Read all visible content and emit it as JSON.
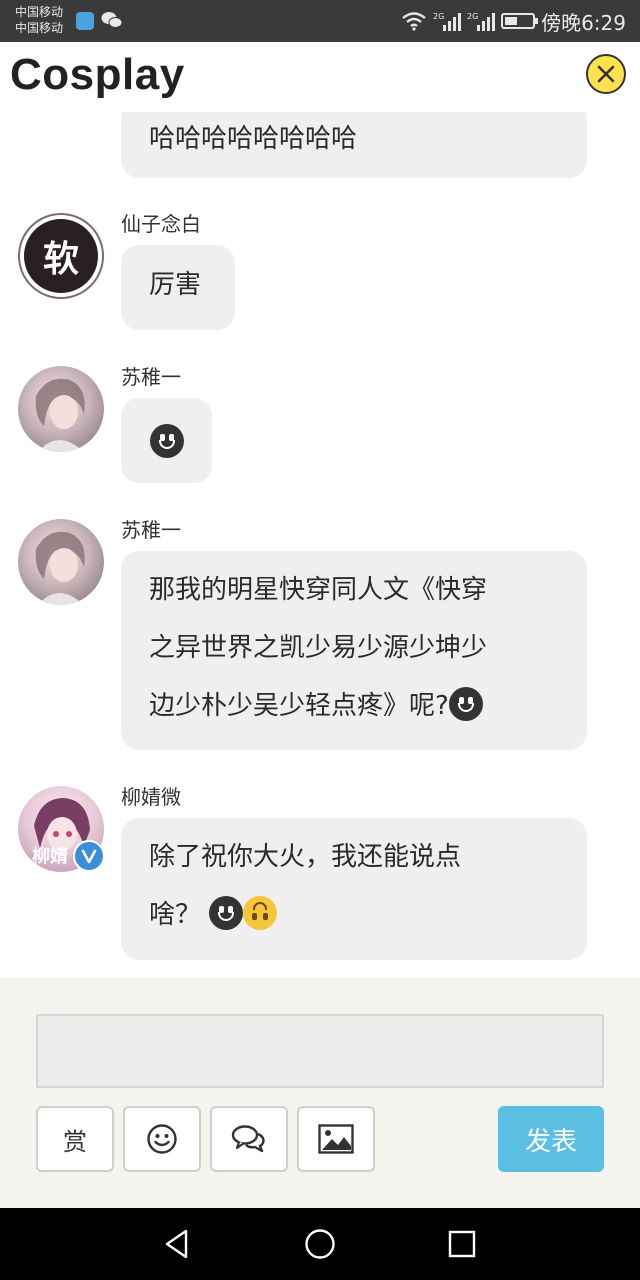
{
  "status_bar": {
    "carrier1": "中国移动",
    "carrier2": "中国移动",
    "network_label1": "2G",
    "network_label2": "2G",
    "time": "傍晚6:29",
    "battery_level": 0.45
  },
  "header": {
    "title": "Cosplay",
    "close_icon": "close-circle-icon"
  },
  "messages": [
    {
      "name": "",
      "text": "哈哈哈哈哈哈哈哈"
    },
    {
      "name": "仙子念白",
      "avatar_text": "软",
      "text": "厉害"
    },
    {
      "name": "苏稚一",
      "text": ""
    },
    {
      "name": "苏稚一",
      "text_lines": [
        "那我的明星快穿同人文《快穿",
        "之异世界之凯少易少源少坤少",
        "边少朴少吴少轻点疼》呢?"
      ]
    },
    {
      "name": "柳婧微",
      "avatar_text": "柳婧",
      "text_lines": [
        "除了祝你大火，我还能说点",
        "啥？"
      ]
    }
  ],
  "composer": {
    "reward_label": "赏",
    "emoji_icon": "smiley-icon",
    "chat_icon": "chat-bubbles-icon",
    "image_icon": "image-icon",
    "send_label": "发表"
  },
  "nav": {
    "back_icon": "back-triangle-icon",
    "home_icon": "home-circle-icon",
    "recents_icon": "recents-square-icon"
  },
  "colors": {
    "accent": "#5bbfe3",
    "close_yellow": "#ffe24d",
    "bubble": "#efefef",
    "composer_bg": "#f4f3ee"
  }
}
